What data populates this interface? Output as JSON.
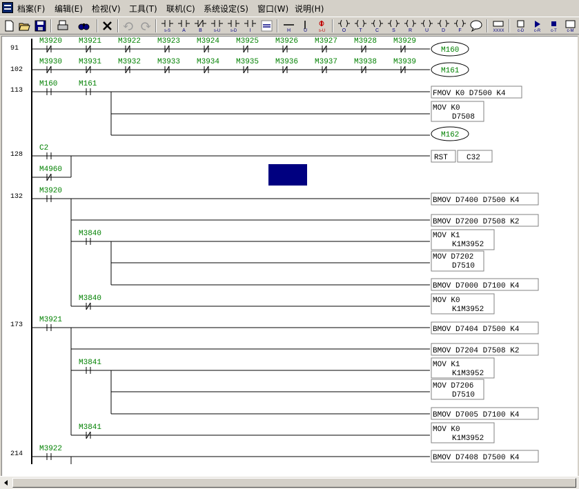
{
  "menu": [
    "档案(F)",
    "编辑(E)",
    "检视(V)",
    "工具(T)",
    "联机(C)",
    "系统设定(S)",
    "窗口(W)",
    "说明(H)"
  ],
  "toolbar": {
    "items": [
      {
        "name": "new-file-icon",
        "label": ""
      },
      {
        "name": "open-folder-icon",
        "label": ""
      },
      {
        "name": "save-icon",
        "label": ""
      },
      {
        "name": "print-icon",
        "label": ""
      },
      {
        "name": "find-icon",
        "label": ""
      },
      {
        "name": "delete-icon",
        "label": ""
      },
      {
        "name": "undo-icon",
        "label": ""
      },
      {
        "name": "redo-icon",
        "label": ""
      },
      {
        "name": "contact-s-s-icon",
        "label": "s-S"
      },
      {
        "name": "contact-a-icon",
        "label": "A"
      },
      {
        "name": "contact-b-icon",
        "label": "B"
      },
      {
        "name": "contact-s-u-icon",
        "label": "s-U"
      },
      {
        "name": "contact-s-d-icon",
        "label": "s-D"
      },
      {
        "name": "contact-i-icon",
        "label": "I"
      },
      {
        "name": "contact-equal-icon",
        "label": ""
      },
      {
        "name": "line-h-icon",
        "label": "H"
      },
      {
        "name": "line-v-icon",
        "label": "U"
      },
      {
        "name": "line-s-u-icon",
        "label": "s-U"
      },
      {
        "name": "coil-o-icon",
        "label": "O"
      },
      {
        "name": "coil-t-icon",
        "label": "T"
      },
      {
        "name": "coil-c-icon",
        "label": "C"
      },
      {
        "name": "coil-s-icon",
        "label": "S"
      },
      {
        "name": "coil-r-icon",
        "label": "R"
      },
      {
        "name": "coil-u-icon",
        "label": "U"
      },
      {
        "name": "coil-d-icon",
        "label": "D"
      },
      {
        "name": "coil-f-icon",
        "label": "F"
      },
      {
        "name": "comment-icon",
        "label": ""
      },
      {
        "name": "xxxx-icon",
        "label": "XXXX"
      },
      {
        "name": "c-d-icon",
        "label": "c-D"
      },
      {
        "name": "c-r-icon",
        "label": "c-R"
      },
      {
        "name": "c-t-icon",
        "label": "c-T"
      },
      {
        "name": "c-m-icon",
        "label": "c-M"
      }
    ]
  },
  "ladder": {
    "step_numbers": [
      "91",
      "102",
      "113",
      "128",
      "132",
      "173",
      "214"
    ],
    "row91": [
      "M3920",
      "M3921",
      "M3922",
      "M3923",
      "M3924",
      "M3925",
      "M3926",
      "M3927",
      "M3928",
      "M3929"
    ],
    "row91_coil": "M160",
    "row102": [
      "M3930",
      "M3931",
      "M3932",
      "M3933",
      "M3934",
      "M3935",
      "M3936",
      "M3937",
      "M3938",
      "M3939"
    ],
    "row102_coil": "M161",
    "contacts": [
      "M160",
      "M161",
      "C2",
      "M4960",
      "M3920",
      "M3840",
      "M3840",
      "M3921",
      "M3841",
      "M3841",
      "M3922"
    ],
    "coil_m162": "M162",
    "instructions": [
      "FMOV K0 D7500 K4",
      "MOV K0",
      "D7508",
      "RST",
      "C32",
      "BMOV D7400 D7500 K4",
      "BMOV D7200 D7508 K2",
      "MOV K1",
      "K1M3952",
      "MOV D7202",
      "D7510",
      "BMOV D7000 D7100 K4",
      "MOV K0",
      "K1M3952",
      "BMOV D7404 D7500 K4",
      "BMOV D7204 D7508 K2",
      "MOV K1",
      "K1M3952",
      "MOV D7206",
      "D7510",
      "BMOV D7005 D7100 K4",
      "MOV K0",
      "K1M3952",
      "BMOV D7408 D7500 K4"
    ]
  }
}
